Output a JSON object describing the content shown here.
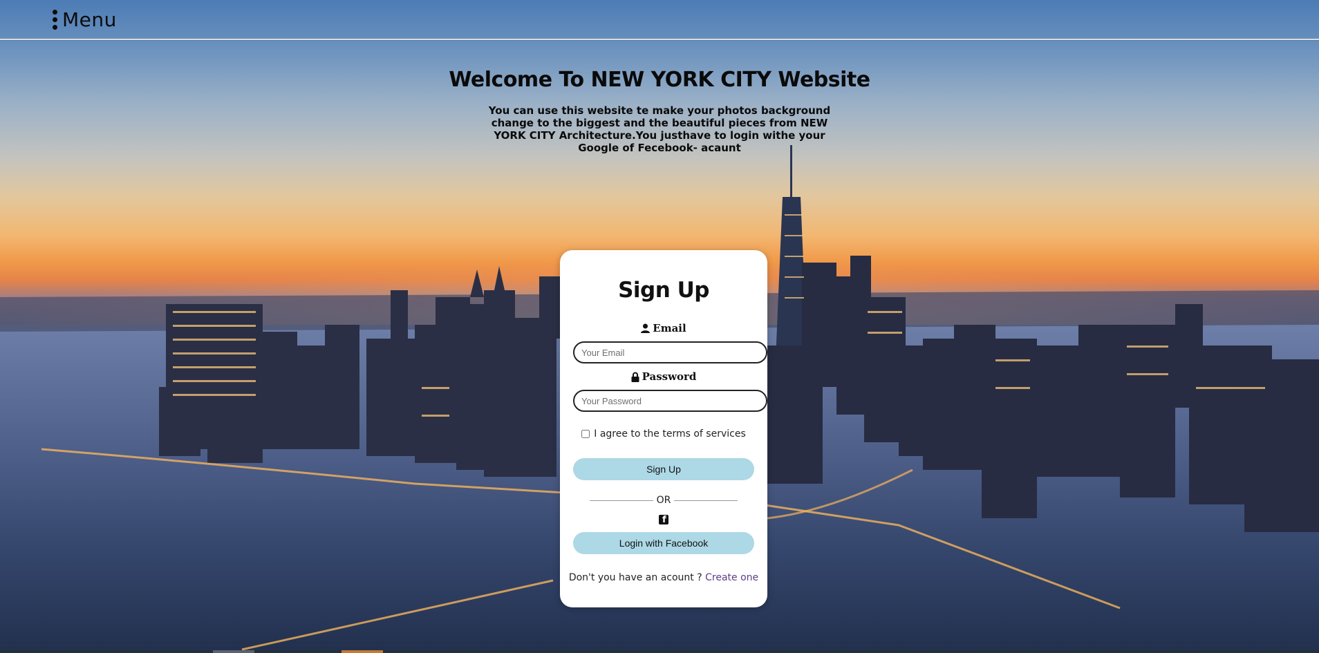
{
  "menu": {
    "label": "Menu",
    "icon": "kebab-vertical-icon"
  },
  "hero": {
    "title": "Welcome To NEW YORK CITY Website",
    "description": "You can use this website te make your photos background change to the biggest and the beautiful pieces from NEW YORK CITY Architecture.You justhave to login withe your Google of Fecebook- acaunt"
  },
  "signup": {
    "title": "Sign Up",
    "email": {
      "label": "Email",
      "icon": "user-icon",
      "placeholder": "Your Email",
      "value": ""
    },
    "password": {
      "label": "Password",
      "icon": "lock-icon",
      "placeholder": "Your Password",
      "value": ""
    },
    "terms_label": "I agree to the terms of services",
    "terms_checked": false,
    "submit_label": "Sign Up",
    "or_label": "OR",
    "facebook_icon": "facebook-square-icon",
    "facebook_label": "Login with Facebook",
    "account_question": "Don't you have an acount ?",
    "create_link": "Create one"
  },
  "colors": {
    "button_bg": "#add8e6",
    "link": "#5b3f86",
    "card_bg": "#ffffff"
  }
}
